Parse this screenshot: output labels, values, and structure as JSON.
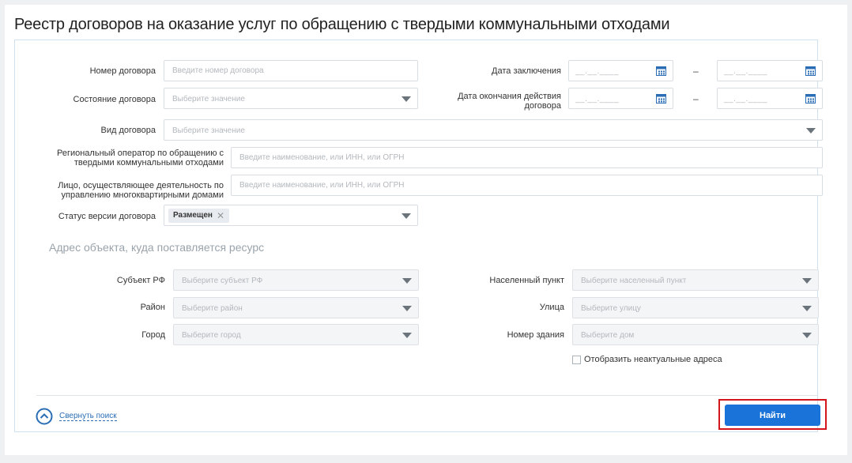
{
  "page": {
    "title": "Реестр договоров на оказание услуг по обращению с твердыми коммунальными отходами"
  },
  "filters": {
    "contract_number": {
      "label": "Номер договора",
      "placeholder": "Введите номер договора"
    },
    "contract_state": {
      "label": "Состояние договора",
      "placeholder": "Выберите значение"
    },
    "contract_type": {
      "label": "Вид договора",
      "placeholder": "Выберите значение"
    },
    "regional_operator": {
      "label": "Региональный оператор по обращению с твердыми коммунальными отходами",
      "placeholder": "Введите наименование, или ИНН, или ОГРН"
    },
    "management_org": {
      "label": "Лицо, осуществляющее деятельность по управлению многоквартирными домами",
      "placeholder": "Введите наименование, или ИНН, или ОГРН"
    },
    "version_status": {
      "label": "Статус версии договора",
      "selected_tag": "Размещен",
      "tag_remove": "✕"
    },
    "conclusion_date": {
      "label": "Дата заключения",
      "from_placeholder": "__.__.____",
      "to_placeholder": "__.__.____",
      "separator": "–"
    },
    "end_date": {
      "label": "Дата окончания действия договора",
      "from_placeholder": "__.__.____",
      "to_placeholder": "__.__.____",
      "separator": "–"
    }
  },
  "address": {
    "section_title": "Адрес объекта, куда поставляется ресурс",
    "subject": {
      "label": "Субъект РФ",
      "placeholder": "Выберите субъект РФ"
    },
    "district": {
      "label": "Район",
      "placeholder": "Выберите район"
    },
    "city": {
      "label": "Город",
      "placeholder": "Выберите город"
    },
    "settlement": {
      "label": "Населенный пункт",
      "placeholder": "Выберите населенный пункт"
    },
    "street": {
      "label": "Улица",
      "placeholder": "Выберите улицу"
    },
    "building": {
      "label": "Номер здания",
      "placeholder": "Выберите дом"
    },
    "show_obsolete": {
      "label": "Отобразить неактуальные адреса",
      "checked": false
    }
  },
  "footer": {
    "collapse_label": "Свернуть поиск",
    "find_label": "Найти"
  },
  "colors": {
    "accent": "#1a73d8",
    "highlight": "#d4161c",
    "panel_border": "#cfe0ef"
  },
  "icons": {
    "date": "calendar-icon",
    "select": "chevron-down-icon",
    "collapse": "chevron-up-circle-icon"
  }
}
